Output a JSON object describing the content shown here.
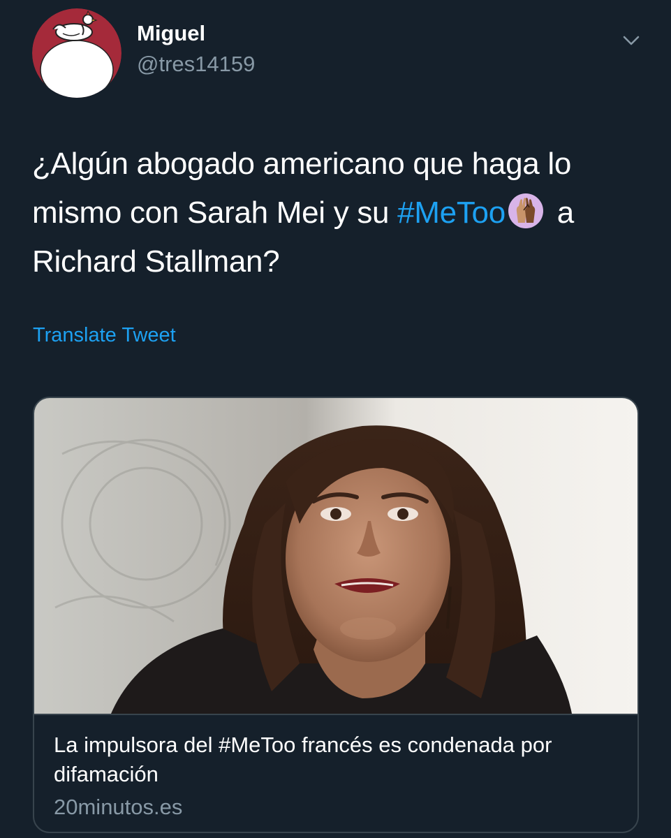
{
  "user": {
    "display_name": "Miguel",
    "handle": "@tres14159",
    "avatar_icon": "chicken-avatar-icon"
  },
  "menu": {
    "caret_icon": "chevron-down-icon"
  },
  "tweet": {
    "text_part1": "¿Algún abogado americano que haga lo mismo con Sarah Mei y su ",
    "hashtag": "#MeToo",
    "emoji_icon": "raised-hands-metoo-emoji-icon",
    "text_part2": " a Richard Stallman?",
    "translate_label": "Translate Tweet"
  },
  "card": {
    "image_icon": "news-photo",
    "title": "La impulsora del #MeToo francés es condenada por difamación",
    "domain": "20minutos.es"
  },
  "colors": {
    "background": "#15202b",
    "link": "#1da1f2",
    "secondary_text": "#8899a6",
    "border": "#38444d",
    "avatar_bg": "#a52a3a"
  }
}
